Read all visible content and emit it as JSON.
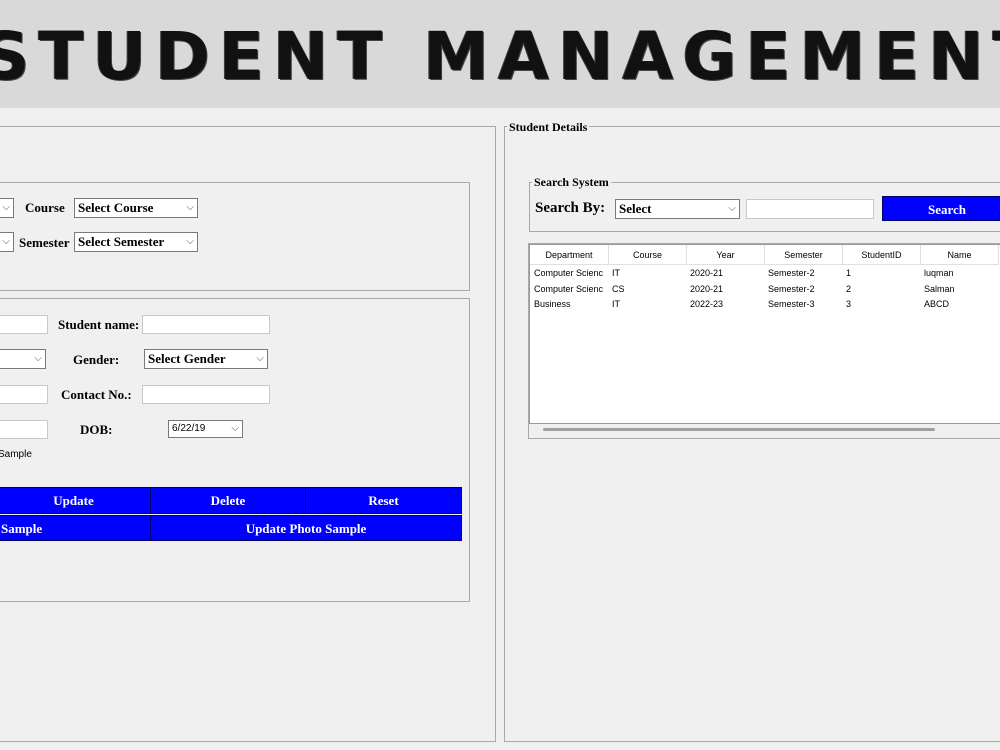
{
  "banner": {
    "title": "STUDENT MANAGEMENT SYS"
  },
  "left_form": {
    "course_label": "Course",
    "course_select": "Select Course",
    "semester_label": "Semester",
    "semester_select": "Select Semester",
    "student_name_label": "Student name:",
    "gender_label": "Gender:",
    "gender_select": "Select Gender",
    "contact_label": "Contact No.:",
    "dob_label": "DOB:",
    "dob_value": "6/22/19",
    "photo_sample_text": "Sample"
  },
  "buttons": {
    "update": "Update",
    "delete": "Delete",
    "reset": "Reset",
    "take_photo_partial": "Sample",
    "update_photo": "Update Photo Sample"
  },
  "details": {
    "frame_label": "Student Details",
    "search_frame_label": "Search System",
    "search_by_label": "Search By:",
    "search_select": "Select",
    "search_button": "Search"
  },
  "table": {
    "columns": [
      "Department",
      "Course",
      "Year",
      "Semester",
      "StudentID",
      "Name"
    ],
    "rows": [
      [
        "Computer Scienc",
        "IT",
        "2020-21",
        "Semester-2",
        "1",
        "luqman"
      ],
      [
        "Computer Scienc",
        "CS",
        "2020-21",
        "Semester-2",
        "2",
        "Salman"
      ],
      [
        "Business",
        "IT",
        "2022-23",
        "Semester-3",
        "3",
        "ABCD"
      ]
    ]
  },
  "icons": {
    "dropdown": "chevron-down-icon"
  },
  "colors": {
    "button_blue": "#0000ff",
    "banner_bg": "#d9d9d9"
  }
}
